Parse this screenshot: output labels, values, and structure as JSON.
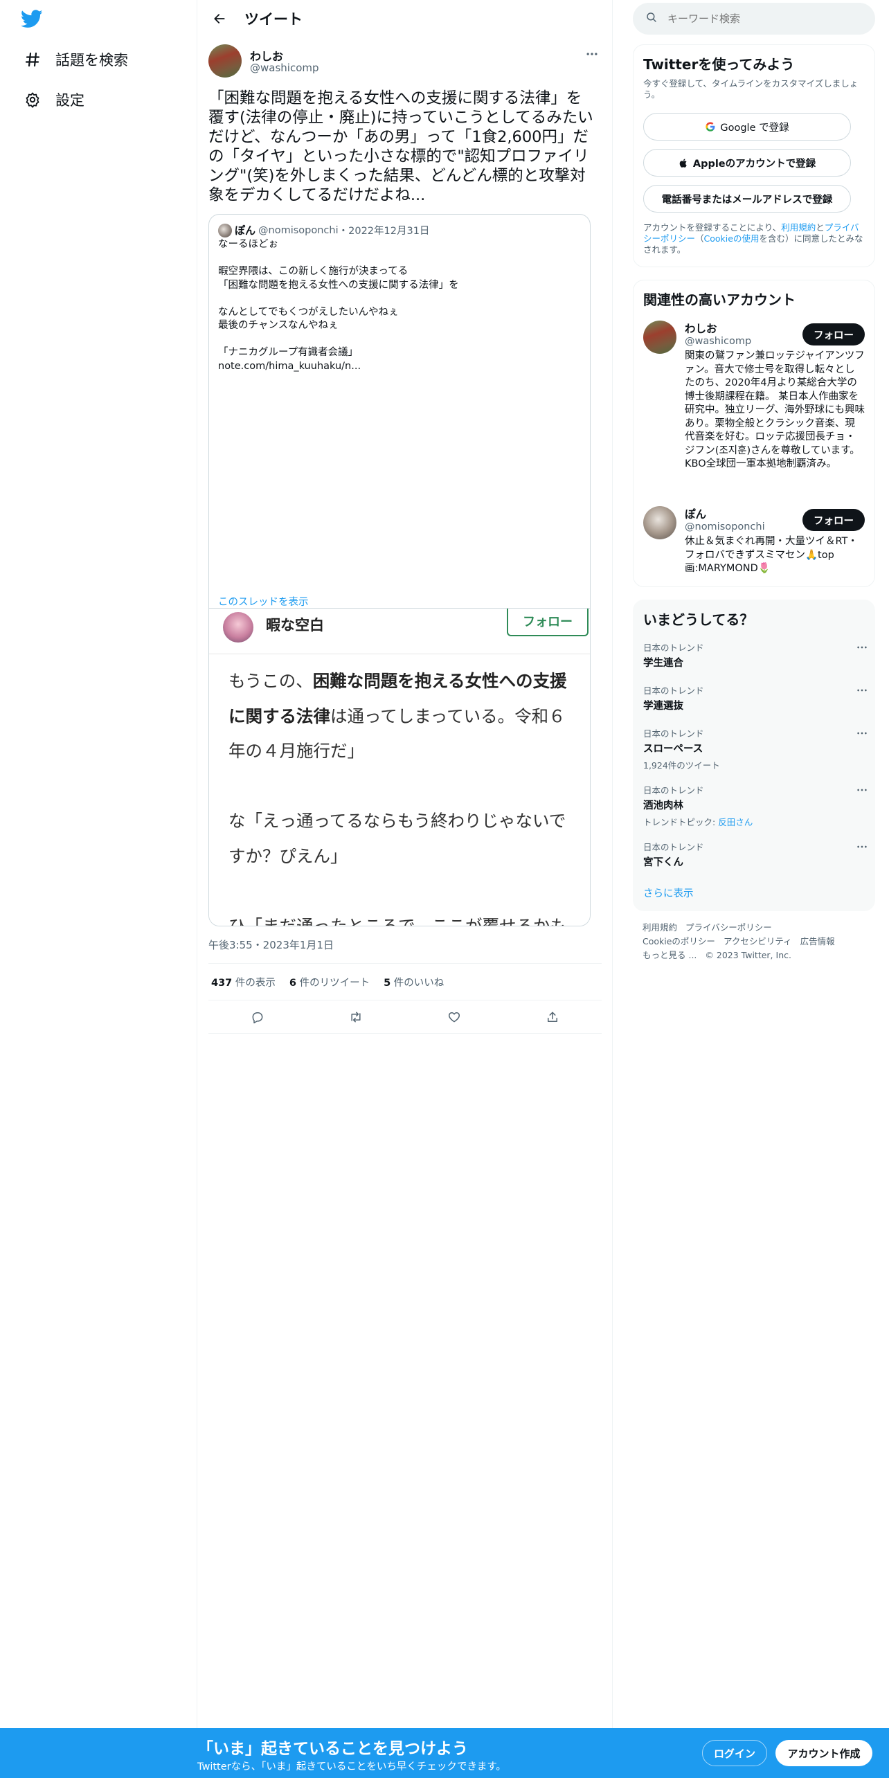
{
  "nav": {
    "logo": "twitter-bird",
    "items": [
      {
        "label": "話題を検索",
        "icon": "hashtag-icon"
      },
      {
        "label": "設定",
        "icon": "gear-icon"
      }
    ]
  },
  "header": {
    "title": "ツイート"
  },
  "tweet": {
    "author_name": "わしお",
    "author_handle": "@washicomp",
    "text": "「困難な問題を抱える女性への支援に関する法律」を覆す(法律の停止・廃止)に持っていこうとしてるみたいだけど、なんつーか「あの男」って「1食2,600円」だの「タイヤ」といった小さな標的で\"認知プロファイリング\"(笑)を外しまくった結果、どんどん標的と攻撃対象をデカくしてるだけだよね...",
    "timestamp": "午後3:55・2023年1月1日",
    "stats": {
      "views_count": "437",
      "views_label": "件の表示",
      "retweets_count": "6",
      "retweets_label": "件のリツイート",
      "likes_count": "5",
      "likes_label": "件のいいね"
    }
  },
  "quote": {
    "author_name": "ぽん",
    "author_handle": "@nomisoponchi",
    "date": "・2022年12月31日",
    "text": "なーるほどぉ\n\n暇空界隈は、この新しく施行が決まってる\n「困難な問題を抱える女性への支援に関する法律」を\n\nなんとしてでもくつがえしたいんやねぇ\n最後のチャンスなんやねぇ\n\n「ナニカグループ有識者会議」\nnote.com/hima_kuuhaku/n...",
    "show_thread": "このスレッドを表示",
    "image": {
      "author": "暇な空白",
      "follow_label": "フォロー",
      "body_prefix": "もうこの、",
      "body_bold": "困難な問題を抱える女性への支援に関する法律",
      "body_rest": "は通ってしまっている。令和６年の４月施行だ」\n\nな「えっ通ってるならもう終わりじゃないですか？ぴえん」\n\nひ「まだ通ったところで、ここが覆せるかもしれない最後のチャンス、崖っぷちなんだ。まさに「困難な問題を抱える女性への支援に係る基本方針等に関する有識者会議」と言ってるように、この法律をどういうふうに運用していきましょうか、という話し合いがこの有識者会議なんだ」"
    }
  },
  "search": {
    "placeholder": "キーワード検索"
  },
  "signup_card": {
    "title": "Twitterを使ってみよう",
    "subtitle": "今すぐ登録して、タイムラインをカスタマイズしましょう。",
    "google": "Google で登録",
    "apple": "Appleのアカウントで登録",
    "phone": "電話番号またはメールアドレスで登録",
    "legal_prefix": "アカウントを登録することにより、",
    "legal_terms": "利用規約",
    "legal_and": "と",
    "legal_privacy": "プライバシーポリシー",
    "legal_mid": "（",
    "legal_cookie": "Cookieの使用",
    "legal_suffix": "を含む）に同意したとみなされます。"
  },
  "relevant": {
    "title": "関連性の高いアカウント",
    "follow_label": "フォロー",
    "accounts": [
      {
        "name": "わしお",
        "handle": "@washicomp",
        "bio": "関東の鷲ファン兼ロッテジャイアンツファン。音大で修士号を取得し転々としたのち、2020年4月より某総合大学の博士後期課程在籍。 某日本人作曲家を研究中。独立リーグ、海外野球にも興味あり。栗物全般とクラシック音楽、現代音楽を好む。ロッテ応援団長チョ・ジフン(조지훈)さんを尊敬しています。KBO全球団一軍本拠地制覇済み。"
      },
      {
        "name": "ぽん",
        "handle": "@nomisoponchi",
        "bio": "休止＆気まぐれ再開・大量ツイ＆RT・フォロバできずスミマセン🙏top画:MARYMOND🌷"
      }
    ]
  },
  "trends": {
    "title": "いまどうしてる？",
    "items": [
      {
        "category": "日本のトレンド",
        "name": "学生連合",
        "sub": ""
      },
      {
        "category": "日本のトレンド",
        "name": "学連選抜",
        "sub": ""
      },
      {
        "category": "日本のトレンド",
        "name": "スローペース",
        "sub": "1,924件のツイート"
      },
      {
        "category": "日本のトレンド",
        "name": "酒池肉林",
        "sub_prefix": "トレンドトピック: ",
        "sub_link": "反田さん"
      },
      {
        "category": "日本のトレンド",
        "name": "宮下くん",
        "sub": ""
      }
    ],
    "show_more": "さらに表示"
  },
  "footer": {
    "links": [
      "利用規約",
      "プライバシーポリシー",
      "Cookieのポリシー",
      "アクセシビリティ",
      "広告情報",
      "もっと見る ...",
      "© 2023 Twitter, Inc."
    ]
  },
  "bottom_bar": {
    "title": "「いま」起きていることを見つけよう",
    "subtitle": "Twitterなら、「いま」起きていることをいち早くチェックできます。",
    "login": "ログイン",
    "signup": "アカウント作成"
  },
  "colors": {
    "accent": "#1d9bf0",
    "text": "#0f1419",
    "secondary": "#536471",
    "follow_green": "#2e8b57"
  }
}
